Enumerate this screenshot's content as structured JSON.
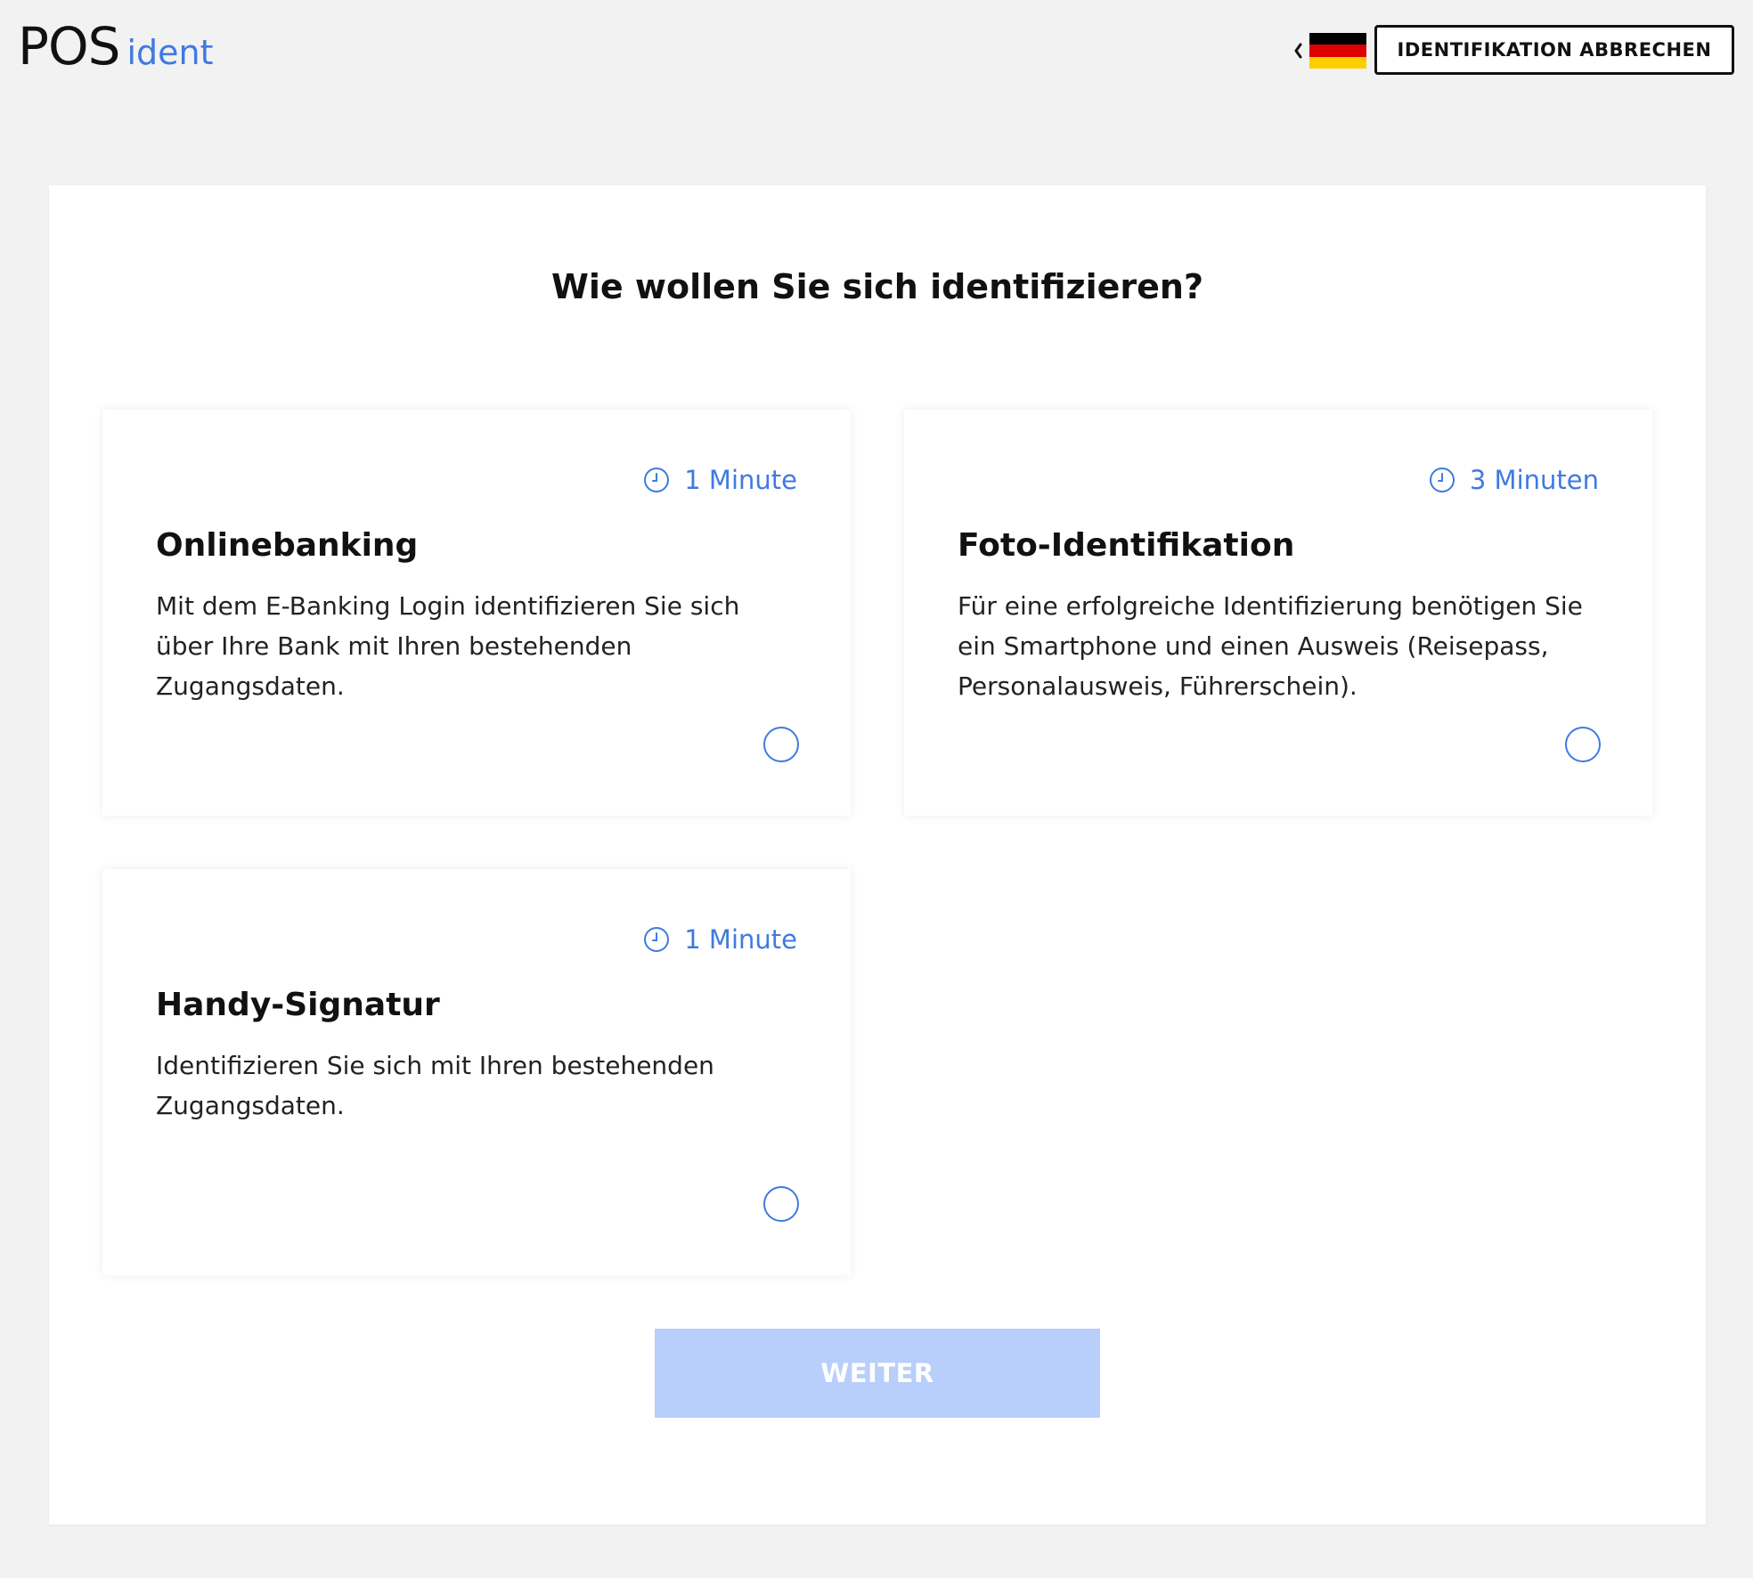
{
  "header": {
    "logo_primary": "POS",
    "logo_secondary": "ident",
    "language": {
      "chevron_icon": "chevron-left-icon",
      "flag_icon": "germany-flag-icon",
      "flag_colors": [
        "#000000",
        "#dd0000",
        "#ffce00"
      ]
    },
    "cancel_label": "IDENTIFIKATION ABBRECHEN"
  },
  "main": {
    "title": "Wie wollen Sie sich identifizieren?",
    "options": [
      {
        "duration": "1 Minute",
        "duration_icon": "clock-icon",
        "title": "Onlinebanking",
        "description": "Mit dem E-Banking Login identifizieren Sie sich über Ihre Bank mit Ihren bestehenden Zugangsdaten.",
        "selected": false
      },
      {
        "duration": "3 Minuten",
        "duration_icon": "clock-icon",
        "title": "Foto-Identifikation",
        "description": "Für eine erfolgreiche Identifizierung benötigen Sie ein Smartphone und einen Ausweis (Reisepass, Personalausweis, Führerschein).",
        "selected": false
      },
      {
        "duration": "1 Minute",
        "duration_icon": "clock-icon",
        "title": "Handy-Signatur",
        "description": "Identifizieren Sie sich mit Ihren bestehenden Zugangsdaten.",
        "selected": false
      }
    ],
    "continue_label": "WEITER",
    "continue_disabled": true
  },
  "colors": {
    "accent": "#3f7ae0",
    "button_disabled": "#b8cefb",
    "background": "#f2f2f2"
  }
}
